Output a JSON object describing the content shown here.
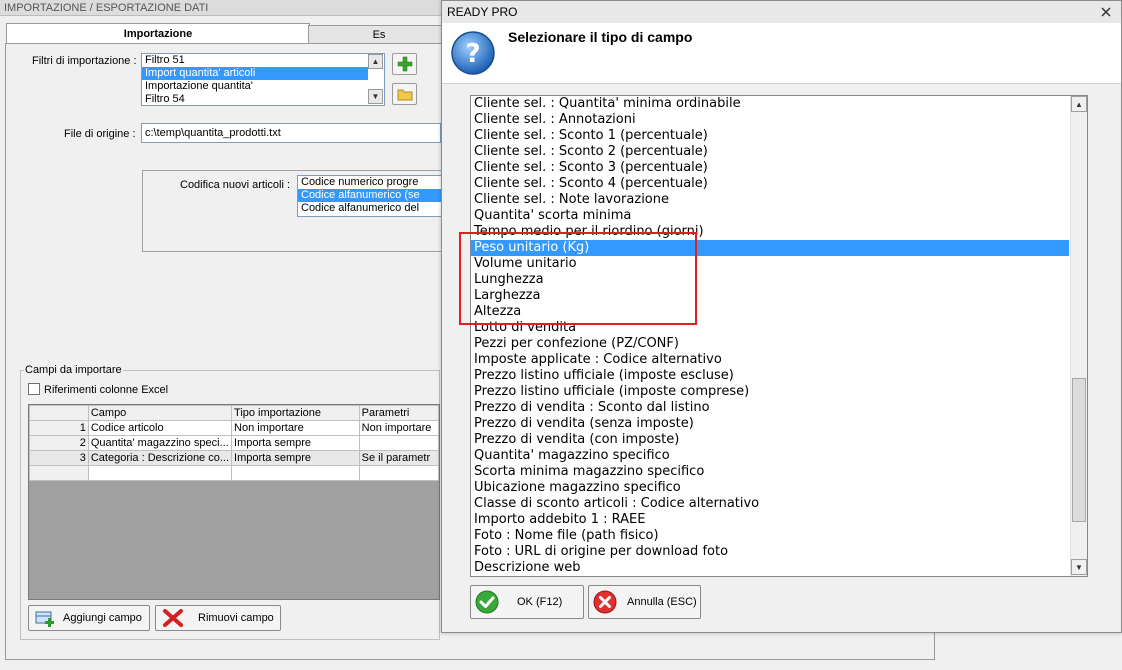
{
  "main": {
    "title": "IMPORTAZIONE / ESPORTAZIONE DATI",
    "tabs": [
      {
        "label": "Importazione",
        "active": true
      },
      {
        "label": "Es"
      }
    ],
    "filtri_label": "Filtri di importazione :",
    "filtri_items": [
      "Filtro 51",
      "Import quantita' articoli",
      "Importazione quantita'",
      "Filtro 54"
    ],
    "filtri_selected_index": 1,
    "file_label": "File di origine :",
    "file_value": "c:\\temp\\quantita_prodotti.txt",
    "codifica_label": "Codifica nuovi articoli :",
    "codifica_items": [
      "Codice numerico progre",
      "Codice alfanumerico (se",
      "Codice alfanumerico del"
    ],
    "codifica_selected_index": 1,
    "campi_group_label": "Campi da importare",
    "excel_checkbox_label": "Riferimenti colonne Excel",
    "excel_checked": false,
    "grid": {
      "columns": [
        "",
        "Campo",
        "Tipo importazione",
        "Parametri"
      ],
      "rows": [
        [
          "1",
          "Codice articolo",
          "Non importare",
          "Non importare"
        ],
        [
          "2",
          "Quantita' magazzino speci...",
          "Importa sempre",
          ""
        ],
        [
          "3",
          "Categoria : Descrizione co...",
          "Importa sempre",
          "Se il parametr"
        ],
        [
          "",
          "",
          "",
          ""
        ]
      ]
    },
    "add_button": "Aggiungi campo",
    "remove_button": "Rimuovi campo"
  },
  "dialog": {
    "title": "READY PRO",
    "heading": "Selezionare il tipo di campo",
    "items": [
      "Cliente sel. : Quantita' minima ordinabile",
      "Cliente sel. : Annotazioni",
      "Cliente sel. : Sconto 1 (percentuale)",
      "Cliente sel. : Sconto 2 (percentuale)",
      "Cliente sel. : Sconto 3 (percentuale)",
      "Cliente sel. : Sconto 4 (percentuale)",
      "Cliente sel. : Note lavorazione",
      "Quantita' scorta minima",
      "Tempo medio per il riordino (giorni)",
      "Peso unitario (Kg)",
      "Volume unitario",
      "Lunghezza",
      "Larghezza",
      "Altezza",
      "Lotto di vendita",
      "Pezzi per confezione (PZ/CONF)",
      "Imposte applicate : Codice alternativo",
      "Prezzo listino ufficiale (imposte escluse)",
      "Prezzo listino ufficiale (imposte comprese)",
      "Prezzo di vendita : Sconto dal listino",
      "Prezzo di vendita (senza imposte)",
      "Prezzo di vendita (con imposte)",
      "Quantita' magazzino specifico",
      "Scorta minima magazzino specifico",
      "Ubicazione magazzino specifico",
      "Classe di sconto articoli : Codice alternativo",
      "Importo addebito 1 : RAEE",
      "Foto : Nome file (path fisico)",
      "Foto : URL di origine per download foto",
      "Descrizione web"
    ],
    "selected_index": 9,
    "ok_button": "OK (F12)",
    "cancel_button": "Annulla (ESC)"
  },
  "colors": {
    "selection": "#3399ff",
    "highlight_box": "#e02020"
  }
}
